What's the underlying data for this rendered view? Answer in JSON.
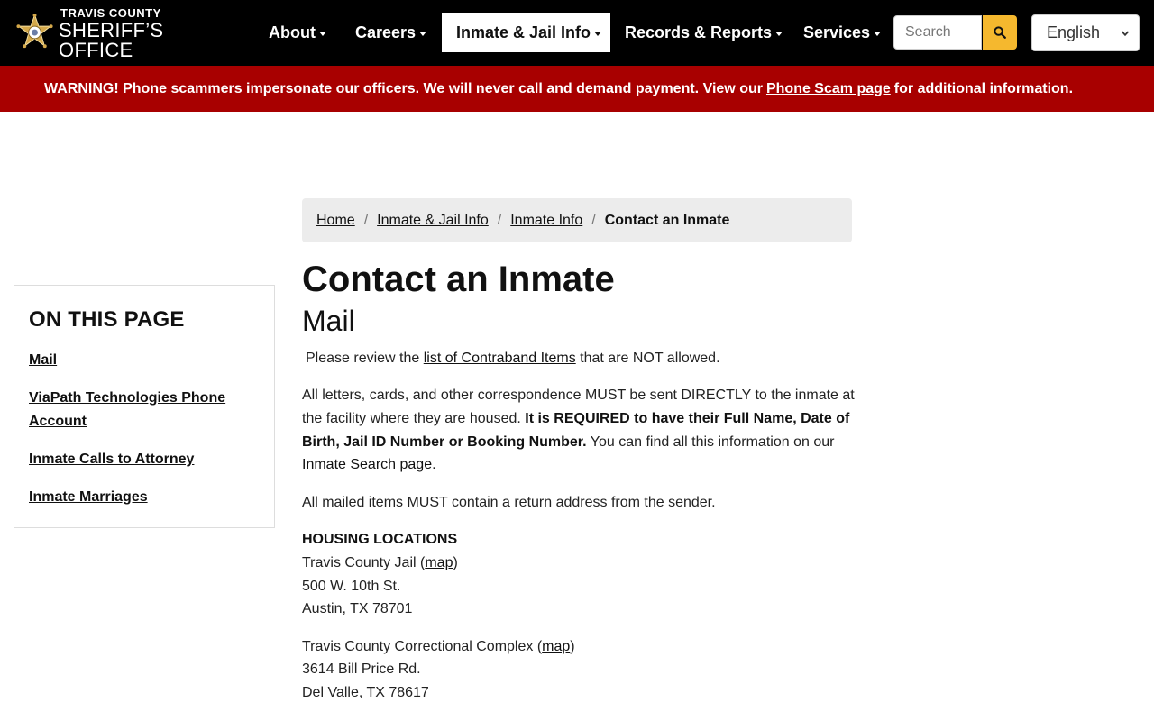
{
  "brand": {
    "top_line": "TRAVIS COUNTY",
    "bottom_line": "SHERIFF’S OFFICE",
    "badge_color": "#d4a84a"
  },
  "nav": {
    "items": [
      {
        "label": "About"
      },
      {
        "label": "Careers"
      },
      {
        "label": "Inmate & Jail Info",
        "active": true
      },
      {
        "label": "Records & Reports"
      },
      {
        "label": "Services"
      }
    ],
    "search_placeholder": "Search",
    "search_button_icon": "search-icon",
    "language_selected": "English",
    "accent_color": "#f5b82e"
  },
  "warning": {
    "text_before": "WARNING! Phone scammers impersonate our officers. We will never call and demand payment. View our",
    "link_text": "Phone Scam page",
    "text_after": "for additional information.",
    "bg_color": "#a80000"
  },
  "breadcrumb": {
    "items": [
      "Home",
      "Inmate & Jail Info",
      "Inmate Info"
    ],
    "current": "Contact an Inmate"
  },
  "sidebar": {
    "title": "ON THIS PAGE",
    "links": [
      "Mail",
      "ViaPath Technologies Phone Account",
      "Inmate Calls to Attorney",
      "Inmate Marriages"
    ]
  },
  "main": {
    "title": "Contact an Inmate",
    "section_title": "Mail",
    "p1": {
      "before": "Please review the",
      "link": "list of Contraband Items",
      "after": "that are NOT allowed."
    },
    "p2": {
      "text1": "All letters, cards, and other correspondence MUST be sent DIRECTLY to the inmate at the facility where they are housed.",
      "bold": "It is REQUIRED to have their Full Name, Date of Birth, Jail ID Number or Booking Number.",
      "text2": "You can find all this information on our",
      "link": "Inmate Search page",
      "end": "."
    },
    "p3": "All mailed items MUST contain a return address from the sender.",
    "housing": {
      "heading": "HOUSING LOCATIONS",
      "locations": [
        {
          "name": "Travis County Jail",
          "map_link": "map",
          "street": "500 W. 10th St.",
          "city": "Austin, TX 78701"
        },
        {
          "name": "Travis County Correctional Complex",
          "map_link": "map",
          "street": "3614 Bill Price Rd.",
          "city": "Del Valle, TX 78617"
        }
      ]
    }
  }
}
